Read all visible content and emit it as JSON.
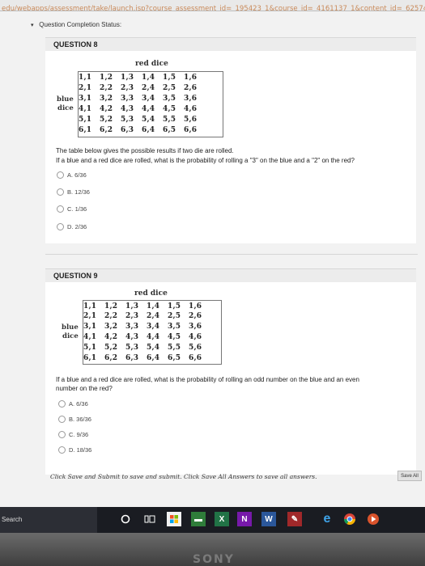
{
  "browser": {
    "url": "edu/webapps/assessment/take/launch.jsp?course_assessment_id=_195423_1&course_id=_4161137_1&content_id=_6257436"
  },
  "status": {
    "label": "Question Completion Status:"
  },
  "dice": {
    "title": "red dice",
    "side_top": "blue",
    "side_bottom": "dice",
    "rows": [
      [
        "1,1",
        "1,2",
        "1,3",
        "1,4",
        "1,5",
        "1,6"
      ],
      [
        "2,1",
        "2,2",
        "2,3",
        "2,4",
        "2,5",
        "2,6"
      ],
      [
        "3,1",
        "3,2",
        "3,3",
        "3,4",
        "3,5",
        "3,6"
      ],
      [
        "4,1",
        "4,2",
        "4,3",
        "4,4",
        "4,5",
        "4,6"
      ],
      [
        "5,1",
        "5,2",
        "5,3",
        "5,4",
        "5,5",
        "5,6"
      ],
      [
        "6,1",
        "6,2",
        "6,3",
        "6,4",
        "6,5",
        "6,6"
      ]
    ]
  },
  "q8": {
    "header": "QUESTION 8",
    "intro": "The table below gives the possible results if two die are rolled.",
    "prompt": "If a blue and a red dice are rolled, what is the probability of rolling a \"3\" on the blue and a \"2\" on the red?",
    "options": [
      "A. 6/36",
      "B. 12/36",
      "C. 1/36",
      "D. 2/36"
    ]
  },
  "q9": {
    "header": "QUESTION 9",
    "prompt_line1": "If a blue and a red dice are rolled, what is the probability of rolling an odd number on the blue and an even",
    "prompt_line2": "number on the red?",
    "options": [
      "A. 6/36",
      "B. 36/36",
      "C. 9/36",
      "D. 18/36"
    ]
  },
  "footer": {
    "instruction": "Click Save and Submit to save and submit. Click Save All Answers to save all answers.",
    "save_all": "Save All"
  },
  "taskbar": {
    "search_label": "Search",
    "icons": [
      "cortana-icon",
      "task-view-icon",
      "store-icon",
      "files-icon",
      "excel-icon",
      "onenote-icon",
      "word-icon",
      "app-icon",
      "edge-icon",
      "chrome-icon",
      "media-icon"
    ]
  },
  "bezel": {
    "brand": "SONY"
  }
}
